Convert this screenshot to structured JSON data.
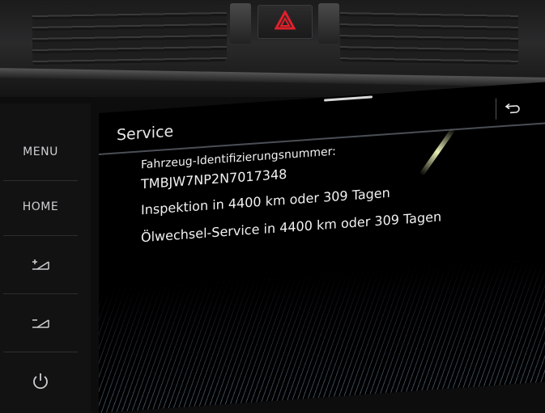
{
  "sidebar": {
    "menu_label": "MENU",
    "home_label": "HOME",
    "volume_up_icon": "volume-up-icon",
    "volume_down_icon": "volume-down-icon",
    "power_icon": "power-icon"
  },
  "screen": {
    "title": "Service",
    "back_icon": "⮌",
    "vin_label": "Fahrzeug-Identifizierungsnummer:",
    "vin_value": "TMBJW7NP2N7017348",
    "inspection": "Inspektion in 4400 km oder 309 Tagen",
    "oil_service": "Ölwechsel-Service in 4400 km oder 309 Tagen"
  },
  "colors": {
    "hazard": "#e0202a",
    "screen_bg": "#000000",
    "text": "#f2f2f2",
    "stripes": "#7896af"
  }
}
